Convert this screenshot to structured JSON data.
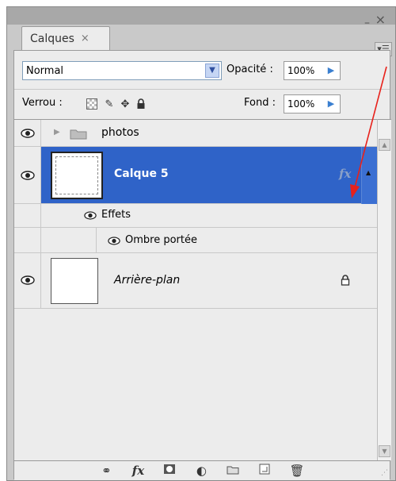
{
  "panel": {
    "tab_label": "Calques",
    "tab_close": "×",
    "min_glyph": "–",
    "close_glyph": "×",
    "menu_glyph": "▾☰"
  },
  "options": {
    "blend_mode": "Normal",
    "opacity_label": "Opacité :",
    "opacity_value": "100%",
    "lock_label": "Verrou :",
    "fill_label": "Fond :",
    "fill_value": "100%"
  },
  "layers": {
    "group_name": "photos",
    "layer5_name": "Calque 5",
    "fx_badge": "fx",
    "effects_label": "Effets",
    "drop_shadow_label": "Ombre portée",
    "background_name": "Arrière-plan"
  },
  "colors": {
    "selected_row": "#2f63c8",
    "annotation_arrow": "#e8211b"
  },
  "icons": {
    "link": "link-icon",
    "fx": "fx-icon",
    "mask": "mask-icon",
    "adjust": "adjustment-icon",
    "folder": "folder-icon",
    "new_layer": "new-layer-icon",
    "trash": "trash-icon"
  }
}
